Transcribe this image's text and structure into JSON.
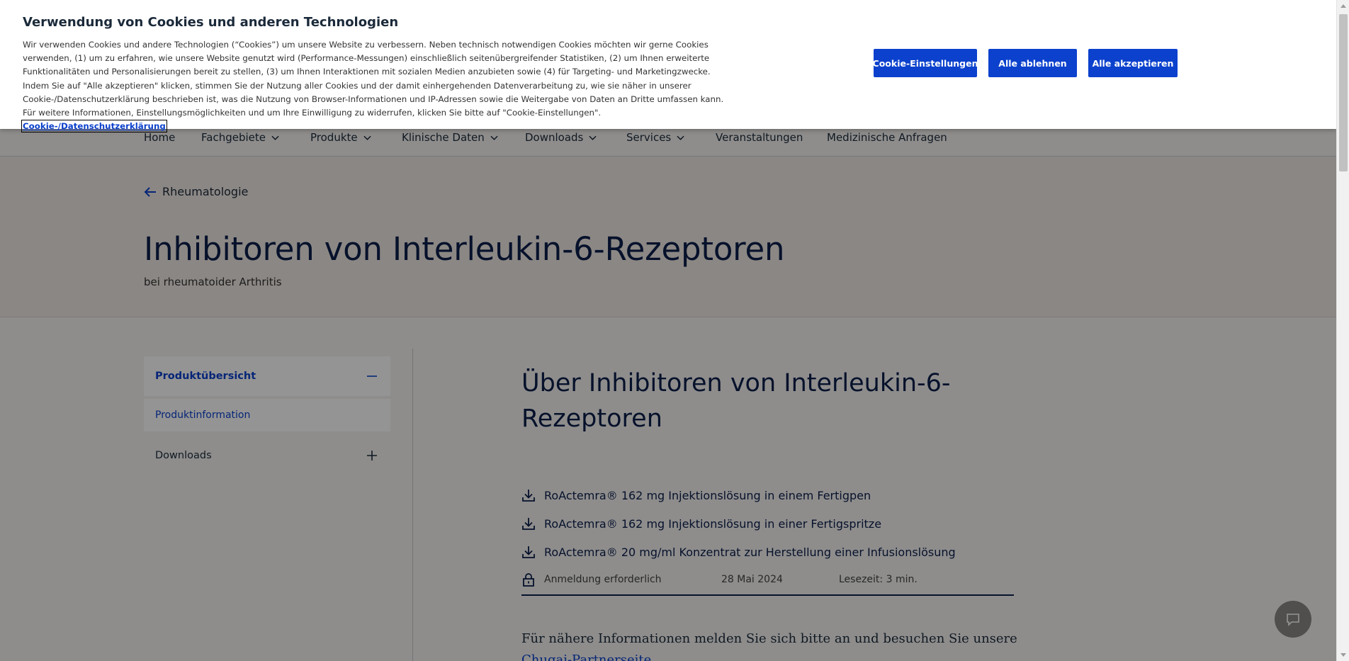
{
  "cookie_banner": {
    "title": "Verwendung von Cookies und anderen Technologien",
    "text": "Wir verwenden Cookies und andere Technologien (“Cookies”) um unsere Website zu verbessern. Neben technisch notwendigen Cookies möchten wir gerne Cookies verwenden, (1) um zu erfahren, wie unsere Website genutzt wird (Performance-Messungen) einschließlich seitenübergreifender Statistiken, (2) um Ihnen erweiterte Funktionalitäten und Personalisierungen bereit zu stellen, (3) um Ihnen Interaktionen mit sozialen Medien anzubieten sowie (4) für Targeting- und Marketingzwecke. Indem Sie auf \"Alle akzeptieren\" klicken, stimmen Sie der Nutzung aller Cookies und der damit einhergehenden Datenverarbeitung zu, wie sie näher in unserer Cookie-/Datenschutzerklärung beschrieben ist, was die Nutzung von Browser-Informationen und IP-Adressen sowie die Weitergabe von Daten an Dritte umfassen kann. Für weitere Informationen, Einstellungsmöglichkeiten und um Ihre Einwilligung zu widerrufen, klicken Sie bitte auf \"Cookie-Einstellungen\".",
    "policy_link": "Cookie-/Datenschutzerklärung",
    "btn_settings": "Cookie-Einstellungen",
    "btn_reject": "Alle ablehnen",
    "btn_accept": "Alle akzeptieren"
  },
  "nav": {
    "items": [
      {
        "label": "Home",
        "dropdown": false
      },
      {
        "label": "Fachgebiete",
        "dropdown": true
      },
      {
        "label": "Produkte",
        "dropdown": true
      },
      {
        "label": "Klinische Daten",
        "dropdown": true
      },
      {
        "label": "Downloads",
        "dropdown": true
      },
      {
        "label": "Services",
        "dropdown": true
      },
      {
        "label": "Veranstaltungen",
        "dropdown": false
      },
      {
        "label": "Medizinische Anfragen",
        "dropdown": false
      }
    ]
  },
  "hero": {
    "back_label": "Rheumatologie",
    "title": "Inhibitoren von Interleukin-6-Rezeptoren",
    "subtitle": "bei rheumatoider Arthritis"
  },
  "sidebar": {
    "section_label": "Produktübersicht",
    "sub_item": "Produktinformation",
    "downloads_label": "Downloads"
  },
  "main": {
    "title": "Über Inhibitoren von Interleukin-6-Rezeptoren",
    "downloads": [
      "RoActemra® 162 mg Injektionslösung in einem Fertigpen",
      "RoActemra® 162 mg Injektionslösung in einer Fertigspritze",
      "RoActemra® 20 mg/ml Konzentrat zur Herstellung einer Infusionslösung"
    ],
    "meta": {
      "login": "Anmeldung erforderlich",
      "date": "28 Mai 2024",
      "reading_time": "Lesezeit: 3 min."
    },
    "para_text": "Für nähere Informationen melden Sie sich bitte an und besuchen Sie unsere",
    "para_link": "Chugai-Partnerseite"
  },
  "colors": {
    "accent": "#0b41cd",
    "heading": "#0b1e4a",
    "hero_bg": "#f0e9e3"
  },
  "icons": {
    "back": "arrow-left-icon",
    "download": "download-icon",
    "lock": "lock-icon",
    "collapse": "minus-icon",
    "expand": "plus-icon",
    "chevron": "chevron-down-icon",
    "chat": "chat-icon"
  }
}
